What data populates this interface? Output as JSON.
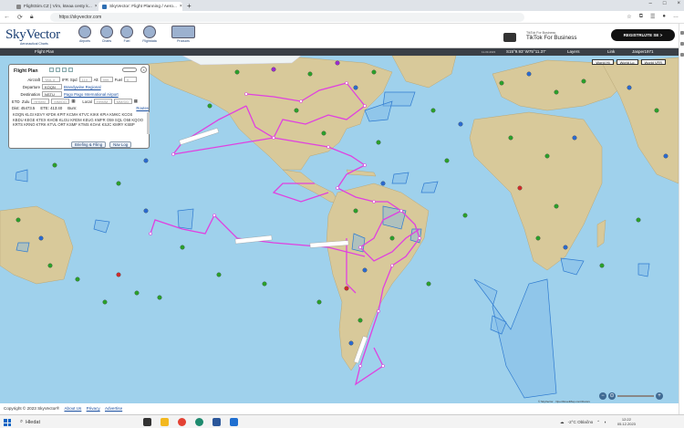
{
  "browser": {
    "tabs": [
      {
        "label": "FlightSim.CZ | Vím, kteaa cesty k...",
        "close": "×",
        "active": false
      },
      {
        "label": "SkyVector: Flight Planning / Aero...",
        "close": "×",
        "active": true
      }
    ],
    "new_tab": "+",
    "url": "https://skyvector.com",
    "window_controls": [
      "–",
      "□",
      "×"
    ],
    "toolbar_icons": [
      "refresh-icon",
      "star-icon",
      "extensions-icon",
      "favorites-icon",
      "profile-icon"
    ]
  },
  "site": {
    "logo": "SkyVector",
    "logo_sub": "Aeronautical Charts",
    "nav": [
      "Airports",
      "Charts",
      "Fuel",
      "Flightdata",
      "Products"
    ],
    "ad": {
      "small": "TikTok For Business",
      "big": "TikTok For Business",
      "button": "REGISTRUJTE SE >"
    }
  },
  "mapbar": {
    "flight_plan": "Flight Plan",
    "version": "11-03-2023",
    "coords": "S15°9.93' W75°11.37'",
    "layers": "Layers",
    "link": "Link",
    "user": "Jasper1971"
  },
  "map": {
    "buttons": [
      "World Hi",
      "World Lo",
      "World VFR"
    ],
    "copyright": "© SkyVector · OpenStreetMap contributors",
    "zoom_in": "+",
    "zoom_out": "−",
    "colors": {
      "ocean": "#9fd1ec",
      "land": "#d9cba0",
      "route": "#e040e0",
      "airspace": "#3f8ed9"
    }
  },
  "flight_plan": {
    "title": "Flight Plan",
    "aircraft_label": "Aircraft",
    "aircraft_value": "TAIL #",
    "ifr": "IFR",
    "spd_label": "Spd",
    "spd_value": "110",
    "alt_label": "Alt",
    "alt_value": "999",
    "fuel_label": "Fuel",
    "fuel_value": "0",
    "departure_label": "Departure",
    "departure_code": "KOQN",
    "departure_name": "Brandywine Regional",
    "destination_label": "Destination",
    "destination_code": "NSTU",
    "destination_name": "Pago Pago International Airport",
    "etd_label": "ETD",
    "zulu_label": "Zulu",
    "zulu_value": "HHMM",
    "zulu_date": "MM/DD",
    "local_label": "Local",
    "local_value": "HHMM",
    "local_date": "MM/DD",
    "dist": "Dist: 45473.5",
    "ete": "ETE: 413:40",
    "burn": "Burn:",
    "routes": "Routes",
    "route_text": "KOQN KLGI KEVY KFDK KPIT KCMH KTVC KIKK KPIA KMKC KCOS KBDU KEGE KTEX KHOB KLGU KRDM KEUG KMFR O59 SQL O58 KQOO KRTS KRNO KTRK KTVL ORT KSMF KTMS KOAK KSJC KMRY KSBP",
    "briefing_btn": "Briefing & Filing",
    "navlog_btn": "Nav Log"
  },
  "footer": {
    "copyright": "Copyright © 2023 SkyVector®",
    "links": [
      "About Us",
      "Privacy",
      "Advertise"
    ]
  },
  "taskbar": {
    "search": "Hledat",
    "weather": "-2°C  Oblačno",
    "time": "12:22",
    "date": "05.12.2023"
  }
}
